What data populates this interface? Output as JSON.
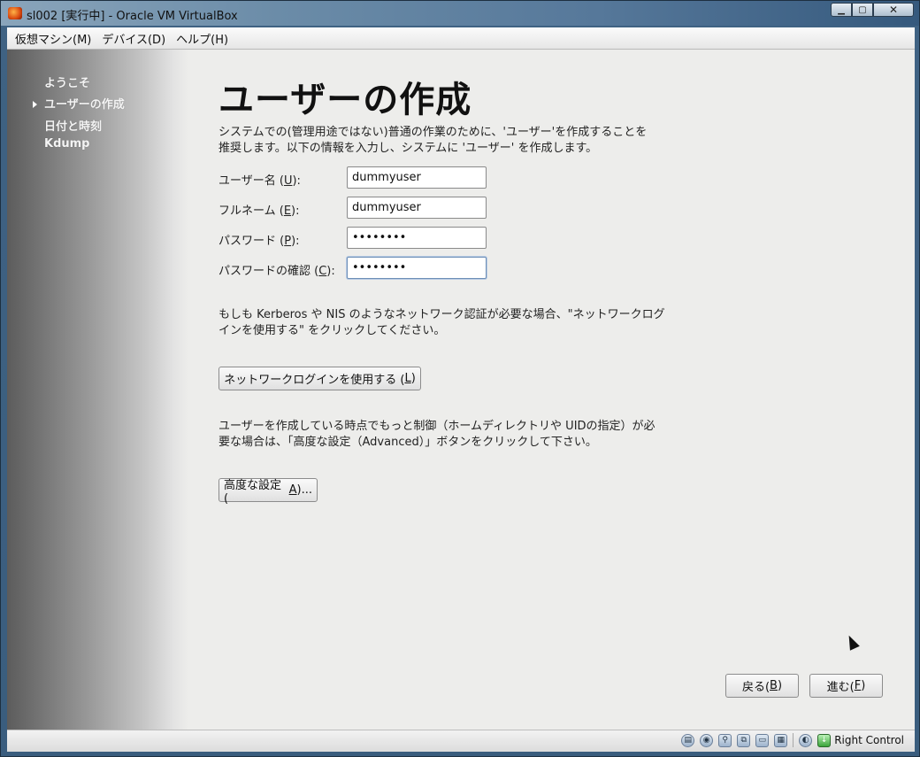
{
  "window": {
    "title": "sl002 [実行中] - Oracle VM VirtualBox",
    "min_label": "▁",
    "max_label": "▢",
    "close_label": "✕"
  },
  "menubar": {
    "items": [
      "仮想マシン(M)",
      "デバイス(D)",
      "ヘルプ(H)"
    ]
  },
  "sidebar": {
    "items": [
      "ようこそ",
      "ユーザーの作成",
      "日付と時刻",
      "Kdump"
    ],
    "current_index": 1
  },
  "main": {
    "heading": "ユーザーの作成",
    "intro_line1": "システムでの(管理用途ではない)普通の作業のために、'ユーザー'を作成することを",
    "intro_line2": "推奨します。以下の情報を入力し、システムに 'ユーザー' を作成します。",
    "fields": {
      "username": {
        "label_pre": "ユーザー名 (",
        "mnemonic": "U",
        "label_post": "):",
        "value": "dummyuser"
      },
      "fullname": {
        "label_pre": "フルネーム (",
        "mnemonic": "E",
        "label_post": "):",
        "value": "dummyuser"
      },
      "password": {
        "label_pre": "パスワード (",
        "mnemonic": "P",
        "label_post": "):",
        "value": "••••••••"
      },
      "confirm": {
        "label_pre": "パスワードの確認 (",
        "mnemonic": "C",
        "label_post": "):",
        "value": "••••••••"
      }
    },
    "network_line1": "もしも Kerberos や NIS のようなネットワーク認証が必要な場合、\"ネットワークログ",
    "network_line2": "インを使用する\" をクリックしてください。",
    "network_button": {
      "pre": "ネットワークログインを使用する (",
      "mnemonic": "L",
      "post": ")"
    },
    "advanced_line1": "ユーザーを作成している時点でもっと制御（ホームディレクトリや UIDの指定）が必",
    "advanced_line2": "要な場合は、「高度な設定（Advanced）」ボタンをクリックして下さい。",
    "advanced_button": {
      "pre": "高度な設定 (",
      "mnemonic": "A",
      "post": ")..."
    },
    "back_button": {
      "pre": "戻る(",
      "mnemonic": "B",
      "post": ")"
    },
    "next_button": {
      "pre": "進む(",
      "mnemonic": "F",
      "post": ")"
    }
  },
  "statusbar": {
    "host_key": "Right Control",
    "icons": [
      "hard-disk-icon",
      "optical-drive-icon",
      "usb-icon",
      "network-icon",
      "shared-folder-icon",
      "display-icon",
      "mouse-integration-icon",
      "host-key-icon"
    ]
  }
}
